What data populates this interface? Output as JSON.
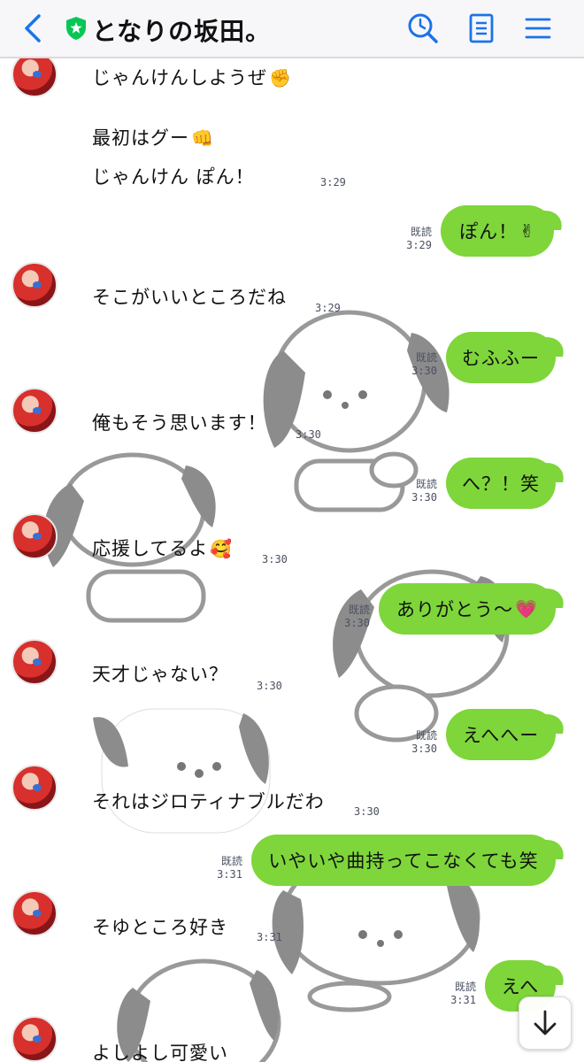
{
  "header": {
    "title": "となりの坂田。",
    "back_icon": "chevron-left-icon",
    "search_icon": "search-icon",
    "notes_icon": "notes-icon",
    "menu_icon": "hamburger-menu-icon",
    "accent_color": "#1a73e8",
    "verified_color": "#06c755"
  },
  "bubble_color": "#7ed63a",
  "read_label": "既読",
  "messages": {
    "m0": {
      "text": "じゃんけんしようぜ",
      "emoji": "✊"
    },
    "m1": {
      "text": "最初はグー",
      "emoji": "👊"
    },
    "m2": {
      "text": "じゃんけん ぽん！",
      "time": "3:29"
    },
    "m3": {
      "text": "ぽん！",
      "emoji": "✌",
      "time": "3:29"
    },
    "m4": {
      "text": "そこがいいところだね",
      "time": "3:29"
    },
    "m5": {
      "text": "むふふー",
      "time": "3:30"
    },
    "m6": {
      "text": "俺もそう思います！",
      "time": "3:30"
    },
    "m7": {
      "text": "へ？！笑",
      "time": "3:30"
    },
    "m8": {
      "text": "応援してるよ",
      "emoji": "🥰",
      "time": "3:30"
    },
    "m9": {
      "text": "ありがとう〜",
      "emoji": "💗",
      "time": "3:30"
    },
    "m10": {
      "text": "天才じゃない？",
      "time": "3:30"
    },
    "m11": {
      "text": "えへへー",
      "time": "3:30"
    },
    "m12": {
      "text": "それはジロティナブルだわ",
      "time": "3:30"
    },
    "m13": {
      "text": "いやいや曲持ってこなくても笑",
      "time": "3:31"
    },
    "m14": {
      "text": "そゆところ好き",
      "time": "3:31"
    },
    "m15": {
      "text": "えへ",
      "time": "3:31"
    },
    "m16": {
      "text": "よしよし可愛い"
    }
  },
  "scroll_down_icon": "arrow-down-icon"
}
